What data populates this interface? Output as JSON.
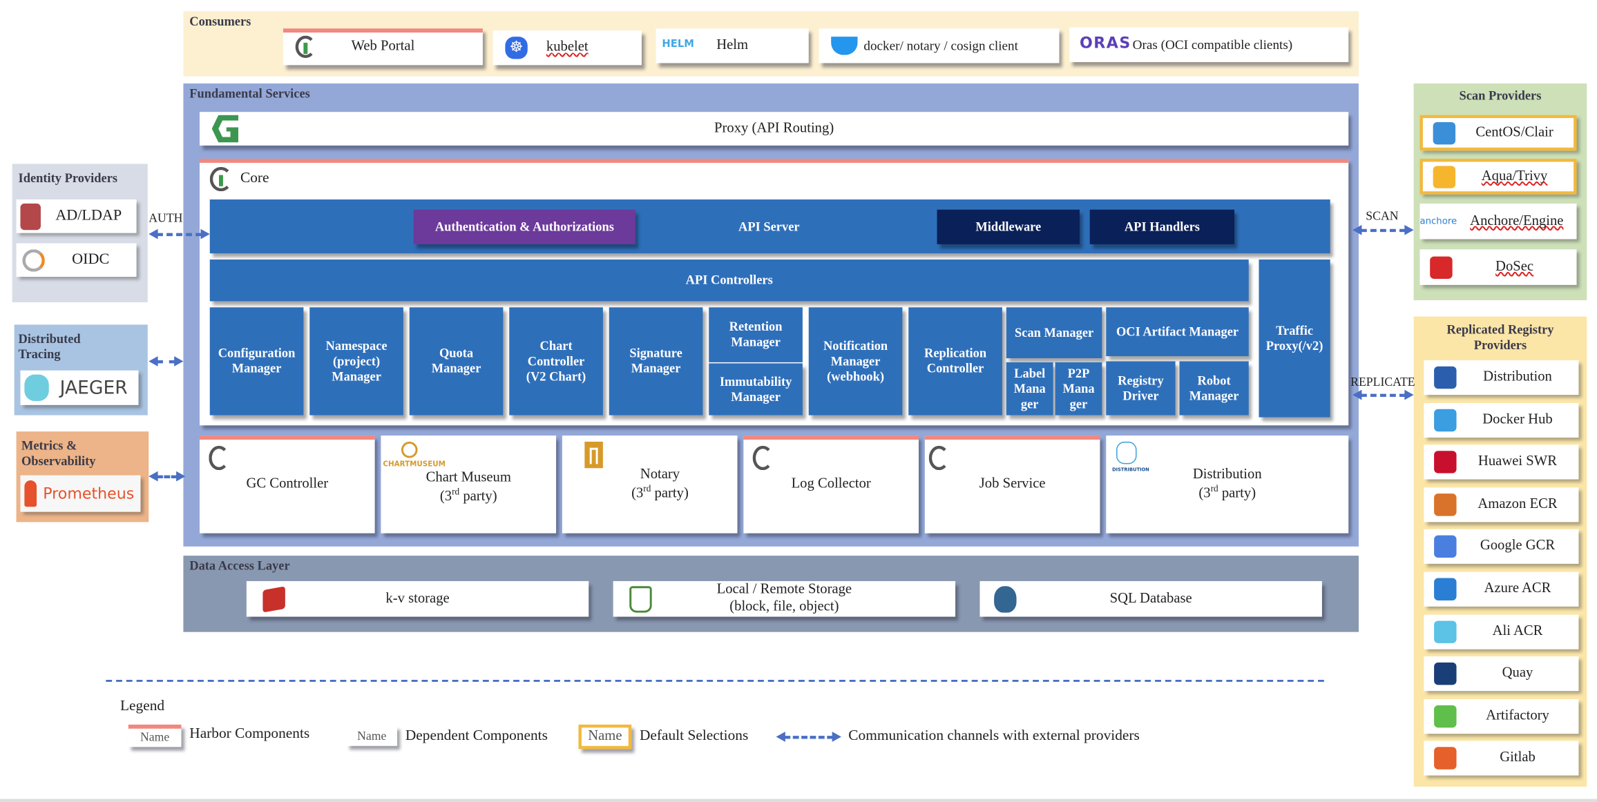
{
  "consumers": {
    "title": "Consumers",
    "items": [
      {
        "label": "Web Portal",
        "icon": "harbor-lighthouse-icon"
      },
      {
        "label": "kubelet",
        "icon": "kubernetes-icon"
      },
      {
        "label": "Helm",
        "icon": "helm-icon",
        "logo_text": "HELM"
      },
      {
        "label": "docker/ notary / cosign client",
        "icon": "docker-whale-icon"
      },
      {
        "label": "Oras (OCI compatible clients)",
        "icon": "oras-logo",
        "logo_text": "ORAS"
      }
    ]
  },
  "fundamental": {
    "title": "Fundamental Services",
    "proxy": "Proxy (API Routing)",
    "core": {
      "title": "Core",
      "auth": "Authentication & Authorizations",
      "api_server": "API Server",
      "middleware": "Middleware",
      "api_handlers": "API Handlers",
      "api_controllers": "API Controllers",
      "traffic_proxy": "Traffic\nProxy(/v2)",
      "managers": {
        "configuration": "Configuration\nManager",
        "namespace": "Namespace\n(project)\nManager",
        "quota": "Quota\nManager",
        "chart": "Chart\nController\n(V2 Chart)",
        "signature": "Signature\nManager",
        "retention": "Retention\nManager",
        "immutability": "Immutability\nManager",
        "notification": "Notification\nManager\n(webhook)",
        "replication": "Replication\nController",
        "scan": "Scan Manager",
        "label": "Label\nMana\nger",
        "p2p": "P2P\nMana\nger",
        "oci_artifact": "OCI Artifact Manager",
        "registry_driver": "Registry\nDriver",
        "robot": "Robot\nManager"
      }
    },
    "components": [
      {
        "label": "GC Controller"
      },
      {
        "label": "Chart Museum",
        "sub_pre": "(3",
        "sub_sup": "rd",
        "sub_post": " party)",
        "logo_text": "CHARTMUSEUM"
      },
      {
        "label": "Notary",
        "sub_pre": "(3",
        "sub_sup": "rd",
        "sub_post": " party)"
      },
      {
        "label": "Log Collector"
      },
      {
        "label": "Job Service"
      },
      {
        "label": "Distribution",
        "sub_pre": "(3",
        "sub_sup": "rd",
        "sub_post": " party)",
        "logo_text": "DISTRIBUTION"
      }
    ]
  },
  "data_access": {
    "title": "Data Access Layer",
    "kv": "k-v storage",
    "storage": "Local / Remote Storage\n(block, file, object)",
    "sql": "SQL Database"
  },
  "identity": {
    "title": "Identity Providers",
    "items": [
      {
        "label": "AD/LDAP",
        "logo_text": "LDAP"
      },
      {
        "label": "OIDC"
      }
    ],
    "arrow_label": "AUTH"
  },
  "tracing": {
    "title": "Distributed\nTracing",
    "item": "JAEGER"
  },
  "metrics": {
    "title": "Metrics &\nObservability",
    "item": "Prometheus"
  },
  "scan": {
    "title": "Scan Providers",
    "arrow_label": "SCAN",
    "items": [
      {
        "label": "CentOS/Clair",
        "default": true,
        "color": "#3b8fd8"
      },
      {
        "label": "Aqua/Trivy",
        "default": true,
        "color": "#f5b62e"
      },
      {
        "label": "Anchore/Engine",
        "default": false,
        "color": "#2f7fcf",
        "logo_text": "anchore"
      },
      {
        "label": "DoSec",
        "default": false,
        "color": "#d8282a"
      }
    ]
  },
  "replicated": {
    "title": "Replicated Registry\nProviders",
    "arrow_label": "REPLICATE",
    "items": [
      {
        "label": "Distribution",
        "color": "#2b5fae"
      },
      {
        "label": "Docker Hub",
        "color": "#3a9ee0"
      },
      {
        "label": "Huawei SWR",
        "color": "#c8102e"
      },
      {
        "label": "Amazon ECR",
        "color": "#d9722a"
      },
      {
        "label": "Google GCR",
        "color": "#4a7fe0"
      },
      {
        "label": "Azure ACR",
        "color": "#2a7fd4"
      },
      {
        "label": "Ali ACR",
        "color": "#5cc2e6"
      },
      {
        "label": "Quay",
        "color": "#1a3e78"
      },
      {
        "label": "Artifactory",
        "color": "#5fbf4a"
      },
      {
        "label": "Gitlab",
        "color": "#e5602a"
      }
    ]
  },
  "legend": {
    "title": "Legend",
    "sample": "Name",
    "harbor": "Harbor Components",
    "dependent": "Dependent Components",
    "default": "Default Selections",
    "channels": "Communication channels with external providers"
  },
  "colors": {
    "consumers_bg": "#fcf0d0",
    "fundamental_bg": "#94a8d8",
    "data_access_bg": "#8898b0",
    "core_blue": "#2e6fba",
    "navy": "#0a2058",
    "auth_purple": "#6b3a9a",
    "harbor_accent": "#f08880",
    "default_gold": "#f3b93c",
    "arrow": "#4a6fc4"
  }
}
